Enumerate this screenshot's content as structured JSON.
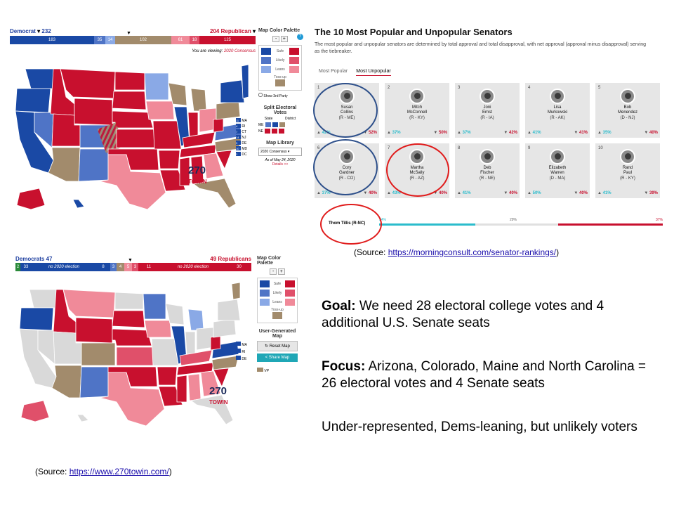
{
  "top_map": {
    "dem_label": "Democrat",
    "dem_total": "232",
    "rep_total": "204",
    "rep_label": "Republican",
    "segments": [
      "183",
      "35",
      "14",
      "102",
      "61",
      "18",
      "125"
    ],
    "viewing_prefix": "You are viewing:",
    "viewing_value": "2020 Consensus",
    "palette_title": "Map Color Palette",
    "palette_labels": [
      "Safe",
      "Likely",
      "Leans",
      "Toss-up"
    ],
    "show_third_party": "Show 3rd Party",
    "split_title": "Split Electoral Votes",
    "split_cols": [
      "State",
      "District"
    ],
    "split_rows": [
      "ME",
      "NE"
    ],
    "small_states": [
      "MA",
      "RI",
      "CT",
      "NJ",
      "DE",
      "MD",
      "DC"
    ],
    "small_states_nums": [
      "11",
      "4",
      "7",
      "14",
      "3",
      "10",
      "3"
    ],
    "library_title": "Map Library",
    "library_select": "2020 Consensus",
    "as_of": "As of May 24, 2020",
    "details": "Details >>",
    "logo": "270",
    "logo_sub": "TOWIN",
    "colors": {
      "safe_dem": "#1a49a5",
      "likely_dem": "#4f74c6",
      "lean_dem": "#8aa9e6",
      "tossup": "#a28b6c",
      "lean_rep": "#f08a99",
      "likely_rep": "#e0506a",
      "safe_rep": "#c8102e"
    }
  },
  "senate_map": {
    "dem_label": "Democrats",
    "dem_total": "47",
    "rep_total": "49",
    "rep_label": "Republicans",
    "segments": [
      "2",
      "33",
      "no 2020 election",
      "8",
      "3",
      "4",
      "5",
      "3",
      "11",
      "no 2020 election",
      "30"
    ],
    "palette_title": "Map Color Palette",
    "palette_labels": [
      "Safe",
      "Likely",
      "Leans",
      "Toss-up"
    ],
    "user_gen_title": "User-Generated Map",
    "reset": "Reset Map",
    "share": "Share Map",
    "small_states": [
      "MA",
      "RI",
      "DE",
      "VP"
    ],
    "logo": "270",
    "logo_sub": "TOWIN"
  },
  "senators": {
    "title": "The 10 Most Popular and Unpopular Senators",
    "desc": "The most popular and unpopular senators are determined by total approval and total disapproval, with net approval (approval minus disapproval) serving as the tiebreaker.",
    "tabs": [
      "Most Popular",
      "Most Unpopular"
    ],
    "cards": [
      {
        "rank": "1",
        "first": "Susan",
        "last": "Collins",
        "party": "(R - ME)",
        "approve": "42%",
        "disapprove": "52%"
      },
      {
        "rank": "2",
        "first": "Mitch",
        "last": "McConnell",
        "party": "(R - KY)",
        "approve": "37%",
        "disapprove": "50%"
      },
      {
        "rank": "3",
        "first": "Joni",
        "last": "Ernst",
        "party": "(R - IA)",
        "approve": "37%",
        "disapprove": "42%"
      },
      {
        "rank": "4",
        "first": "Lisa",
        "last": "Murkowski",
        "party": "(R - AK)",
        "approve": "41%",
        "disapprove": "41%"
      },
      {
        "rank": "5",
        "first": "Bob",
        "last": "Menendez",
        "party": "(D - NJ)",
        "approve": "35%",
        "disapprove": "40%"
      },
      {
        "rank": "6",
        "first": "Cory",
        "last": "Gardner",
        "party": "(R - CO)",
        "approve": "37%",
        "disapprove": "40%"
      },
      {
        "rank": "7",
        "first": "Martha",
        "last": "McSally",
        "party": "(R - AZ)",
        "approve": "43%",
        "disapprove": "40%"
      },
      {
        "rank": "8",
        "first": "Deb",
        "last": "Fischer",
        "party": "(R - NE)",
        "approve": "41%",
        "disapprove": "40%"
      },
      {
        "rank": "9",
        "first": "Elizabeth",
        "last": "Warren",
        "party": "(D - MA)",
        "approve": "50%",
        "disapprove": "40%"
      },
      {
        "rank": "10",
        "first": "Rand",
        "last": "Paul",
        "party": "(R - KY)",
        "approve": "41%",
        "disapprove": "39%"
      }
    ],
    "tillis_name": "Thom Tillis (R-NC)",
    "tillis_approve": "34%",
    "tillis_neutral": "29%",
    "tillis_disapprove": "37%",
    "source_prefix": "(Source: ",
    "source_link": "https://morningconsult.com/senator-rankings/",
    "source_suffix": ")"
  },
  "notes": {
    "goal_label": "Goal:",
    "goal_text": " We need 28 electoral college votes and 4 additional U.S. Senate seats",
    "focus_label": "Focus:",
    "focus_text": " Arizona, Colorado, Maine and North Carolina = 26 electoral votes and 4 Senate seats",
    "under_text": "Under-represented, Dems-leaning, but unlikely voters"
  },
  "bottom_source": {
    "prefix": "(Source: ",
    "link": "https://www.270towin.com/",
    "suffix": ")"
  }
}
